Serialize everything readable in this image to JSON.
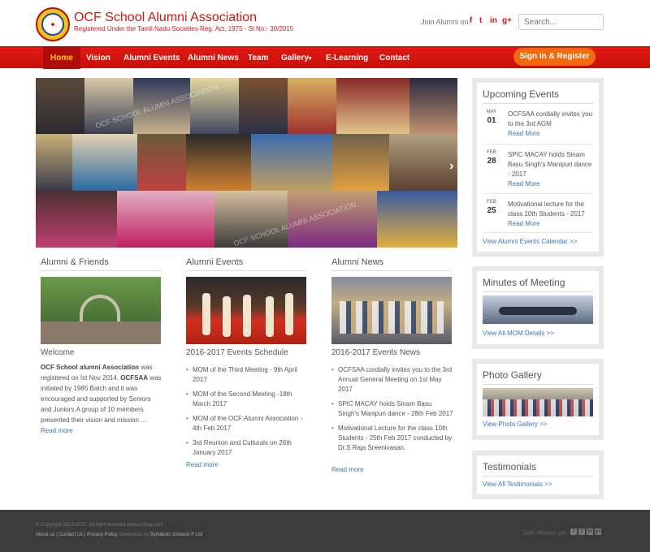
{
  "header": {
    "title": "OCF School Alumni Association",
    "subtitle": "Registered Under the Tamil Nadu Societies Reg. Act, 1975 - Sl.No:- 30/2015",
    "join_label": "Join Alumni on:",
    "social": [
      "f",
      "t",
      "in",
      "g+"
    ],
    "search_placeholder": "Search..."
  },
  "nav": {
    "items": [
      "Home",
      "Vision",
      "Alumni Events",
      "Alumni News",
      "Team",
      "Gallery",
      "E-Learning",
      "Contact"
    ],
    "gallery_caret": "▾",
    "signin": "Sign In & Register"
  },
  "hero": {
    "watermark": "OCF SCHOOL ALUMNI ASSOCIATION",
    "next_arrow": "›"
  },
  "columns": {
    "friends": {
      "title": "Alumni & Friends",
      "heading": "Welcome",
      "text_bold1": "OCF School alumni Association",
      "text1": " was registered on Ist Nov 2014. ",
      "text_bold2": "OCFSAA",
      "text2": " was initiated by 1985 Batch and it was encouraged and supported by Seniors and Juniors.A group of 10 members presented their vision and mission ...",
      "read_more": "Read more"
    },
    "events": {
      "title": "Alumni Events",
      "heading": "2016-2017 Events Schedule",
      "items": [
        "MOM of the Third Meeting - 9th April 2017",
        "MOM of the Second Meeting -18th March 2017",
        "MOM of the OCF:Alumni Association - 4th Feb 2017",
        "3rd Reunion and Culturals on 26th January 2017"
      ],
      "read_more": "Read more"
    },
    "news": {
      "title": "Alumni News",
      "heading": "2016-2017 Events News",
      "items": [
        "OCFSAA cordially invites you to the 3rd Annual General Meeting on 1st May 2017",
        "SPIC MACAY holds Sinam Basu Singh's Manipuri dance - 28th Feb 2017",
        "Motivational Lecture for the class 10th Students - 25th Feb 2017 conducted by Dr.S Raja Sreenivasan."
      ],
      "read_more": "Read more"
    }
  },
  "sidebar": {
    "upcoming": {
      "title": "Upcoming Events",
      "events": [
        {
          "month": "MAY",
          "day": "01",
          "text": "OCFSAA cordially invites you to the 3rd AGM",
          "more": "Read More"
        },
        {
          "month": "FEB",
          "day": "28",
          "text": "SPIC MACAY holds Sinam Basu Singh's Manipuri dance - 2017",
          "more": "Read More"
        },
        {
          "month": "FEB",
          "day": "25",
          "text": "Motivational lecture for the class 10th Students - 2017",
          "more": "Read More"
        }
      ],
      "link": "View Alumni Events Calendar >>"
    },
    "mom": {
      "title": "Minutes of Meeting",
      "link": "View All MOM Details >>"
    },
    "gallery": {
      "title": "Photo Gallery",
      "link": "View Photo Gallery >>"
    },
    "testimonials": {
      "title": "Testimonials",
      "link": "View All Testimonials >>"
    }
  },
  "footer": {
    "copyright": "© Copyright 2015-2017. All right reserved www.ocfsaa.com",
    "links": [
      "About us",
      "Contact Us",
      "Privacy Policy"
    ],
    "developed_by": "Developed by",
    "developer": "Symbiotic Infotech P Ltd",
    "join_label": "Join Alumni on:"
  },
  "colors": {
    "brand_red": "#d01616",
    "nav_red": "#e01a12",
    "active_text": "#ffcc00",
    "signin_orange": "#f26a10",
    "link_blue": "#3a78b5"
  }
}
